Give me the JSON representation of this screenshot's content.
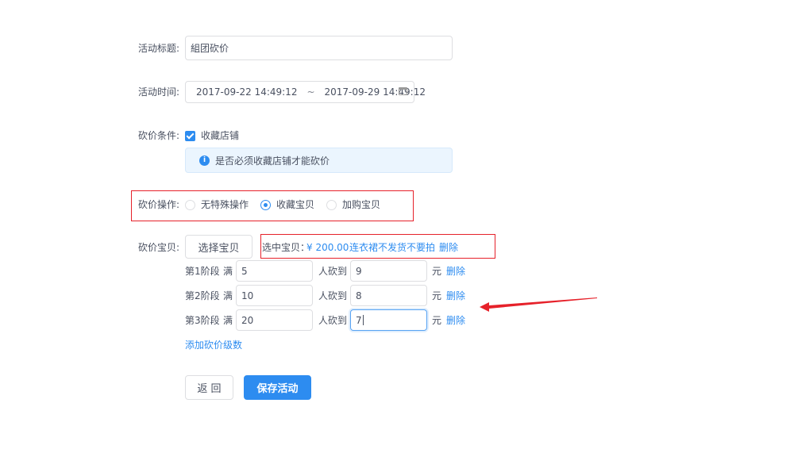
{
  "form": {
    "title_label": "活动标题:",
    "title_value": "組团砍价",
    "time_label": "活动时间:",
    "time_start": "2017-09-22 14:49:12",
    "time_sep": "~",
    "time_end": "2017-09-29 14:49:12",
    "condition_label": "砍价条件:",
    "condition_checkbox_label": "收藏店铺",
    "condition_info": "是否必须收藏店铺才能砍价",
    "info_icon_glyph": "i",
    "operation_label": "砍价操作:",
    "operation_options": [
      "无特殊操作",
      "收藏宝贝",
      "加购宝贝"
    ],
    "operation_selected": "收藏宝贝",
    "item_label": "砍价宝贝:",
    "select_item_button": "选择宝贝",
    "selected_prefix": "选中宝贝：",
    "selected_price": "¥ 200.00",
    "selected_name": "连衣裙不发货不要拍",
    "selected_delete": "删除",
    "stage_full": "满",
    "stage_people": "人砍到",
    "stage_unit": "元",
    "stage_delete": "删除",
    "stages": [
      {
        "label": "第1阶段",
        "people": "5",
        "price": "9"
      },
      {
        "label": "第2阶段",
        "people": "10",
        "price": "8"
      },
      {
        "label": "第3阶段",
        "people": "20",
        "price": "7"
      }
    ],
    "add_stage": "添加砍价级数",
    "back_button": "返 回",
    "save_button": "保存活动"
  },
  "colors": {
    "primary": "#2d8cf0",
    "annotation_red": "#e6212a",
    "info_bg": "#ebf5fe"
  }
}
